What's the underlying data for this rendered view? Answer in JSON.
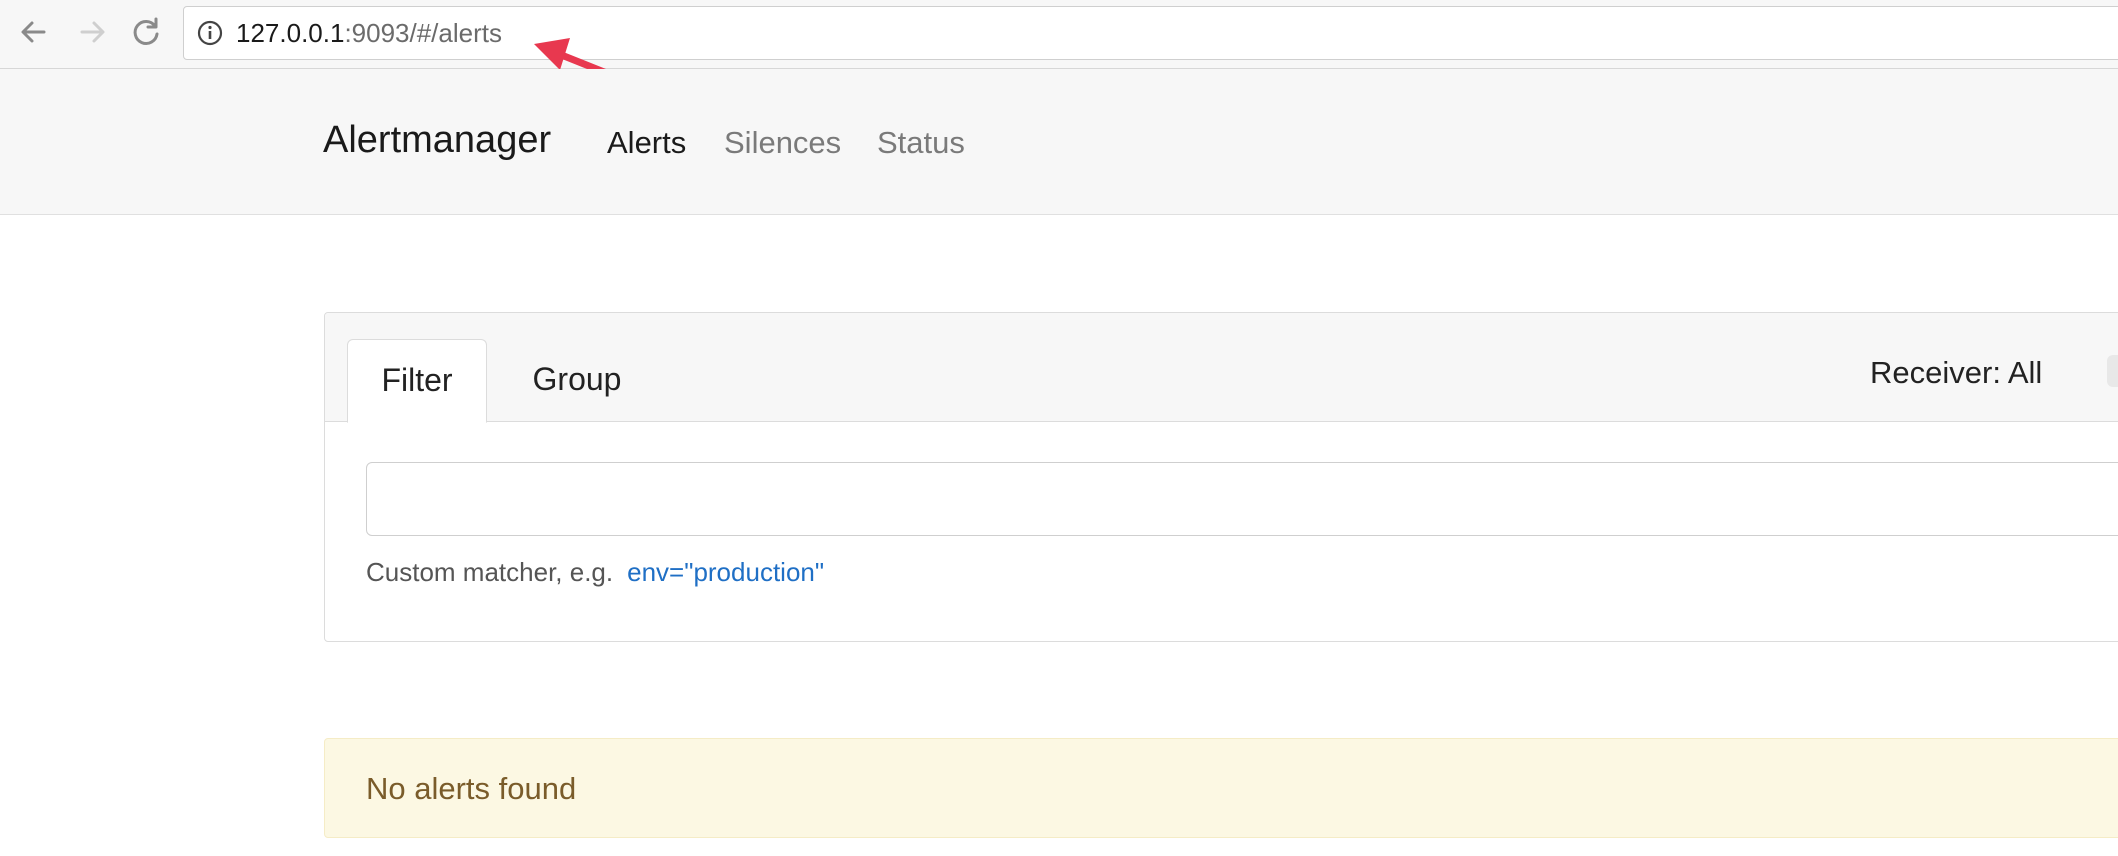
{
  "browser": {
    "url_host": "127.0.0.1",
    "url_rest": ":9093/#/alerts",
    "icons": {
      "back": "arrow-left-icon",
      "forward": "arrow-right-icon",
      "reload": "reload-icon",
      "info": "info-icon"
    }
  },
  "navbar": {
    "brand": "Alertmanager",
    "links": [
      {
        "label": "Alerts",
        "active": true
      },
      {
        "label": "Silences",
        "active": false
      },
      {
        "label": "Status",
        "active": false
      }
    ]
  },
  "filter_panel": {
    "tabs": [
      {
        "label": "Filter",
        "active": true
      },
      {
        "label": "Group",
        "active": false
      }
    ],
    "receiver_label": "Receiver: All",
    "input_value": "",
    "hint_text": "Custom matcher, e.g.",
    "hint_example": "env=\"production\""
  },
  "alerts": {
    "empty_message": "No alerts found"
  },
  "colors": {
    "annotation_arrow": "#e8384f",
    "link": "#1f6fc5",
    "alert_bg": "#fcf8e3",
    "alert_text": "#7a5c2a"
  }
}
